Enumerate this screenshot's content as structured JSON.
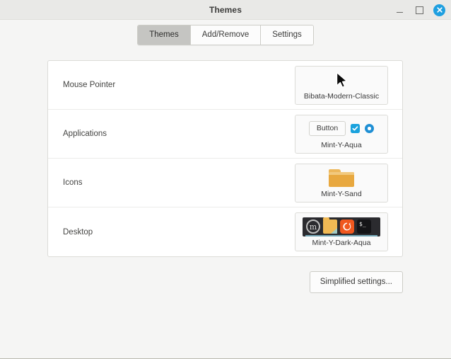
{
  "window": {
    "title": "Themes",
    "controls": {
      "minimize": "minimize",
      "maximize": "maximize",
      "close": "close"
    },
    "close_color": "#1e9fe0"
  },
  "tabs": [
    {
      "label": "Themes",
      "active": true
    },
    {
      "label": "Add/Remove",
      "active": false
    },
    {
      "label": "Settings",
      "active": false
    }
  ],
  "rows": [
    {
      "label": "Mouse Pointer",
      "value": "Bibata-Modern-Classic",
      "preview": "cursor-arrow"
    },
    {
      "label": "Applications",
      "value": "Mint-Y-Aqua",
      "preview": "widget-sample",
      "widgets": {
        "button_label": "Button",
        "checkbox_checked": true,
        "radio_selected": true,
        "accent_color": "#1aa2dd"
      }
    },
    {
      "label": "Icons",
      "value": "Mint-Y-Sand",
      "preview": "folder-icon",
      "folder_color": "#e8a83f"
    },
    {
      "label": "Desktop",
      "value": "Mint-Y-Dark-Aqua",
      "preview": "panel-strip",
      "panel": {
        "background": "#2b2b2f",
        "accent_color": "#8fd4e8",
        "icons": [
          "mint-logo",
          "folder",
          "firefox",
          "terminal"
        ],
        "mint_glyph": "m",
        "terminal_glyph": "$_"
      }
    }
  ],
  "footer": {
    "simplified_settings_label": "Simplified settings..."
  }
}
